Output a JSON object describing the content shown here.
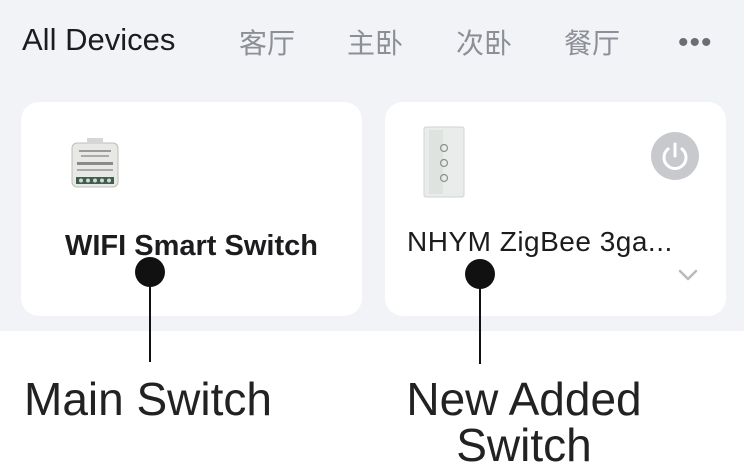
{
  "tabs": {
    "items": [
      "All Devices",
      "客厅",
      "主卧",
      "次卧",
      "餐厅"
    ],
    "more_label": "•••"
  },
  "devices": [
    {
      "name": "WIFI Smart Switch"
    },
    {
      "name": "NHYM ZigBee 3ga..."
    }
  ],
  "annotations": {
    "main_switch": "Main Switch",
    "new_added_line1": "New Added",
    "new_added_line2": "Switch"
  },
  "colors": {
    "background": "#f2f3f7",
    "card": "#ffffff",
    "power_button": "#c7c9cd"
  }
}
